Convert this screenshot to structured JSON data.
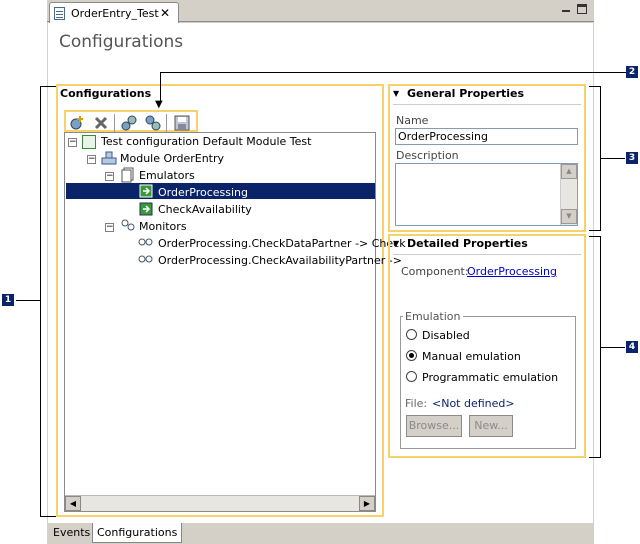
{
  "editor": {
    "tab_title": "OrderEntry_Test",
    "page_title": "Configurations"
  },
  "configurations": {
    "section_title": "Configurations",
    "toolbar": [
      "add-icon",
      "delete-icon",
      "link-icon",
      "unlink-icon",
      "save-icon"
    ],
    "tree": {
      "root": "Test configuration Default Module Test",
      "module": "Module OrderEntry",
      "emulators": "Emulators",
      "emulator_items": [
        "OrderProcessing",
        "CheckAvailability"
      ],
      "monitors": "Monitors",
      "monitor_items": [
        "OrderProcessing.CheckDataPartner -> Check",
        "OrderProcessing.CheckAvailabilityPartner ->"
      ]
    }
  },
  "general": {
    "title": "General Properties",
    "name_label": "Name",
    "name_value": "OrderProcessing",
    "description_label": "Description"
  },
  "detailed": {
    "title": "Detailed Properties",
    "component_label": "Component:",
    "component_value": "OrderProcessing",
    "emulation_group": "Emulation",
    "options": [
      "Disabled",
      "Manual emulation",
      "Programmatic emulation"
    ],
    "selected": "Manual emulation",
    "file_label": "File:",
    "file_value": "<Not defined>",
    "browse_button": "Browse...",
    "new_button": "New..."
  },
  "bottom_tabs": [
    "Events",
    "Configurations"
  ],
  "callouts": [
    "1",
    "2",
    "3",
    "4"
  ]
}
